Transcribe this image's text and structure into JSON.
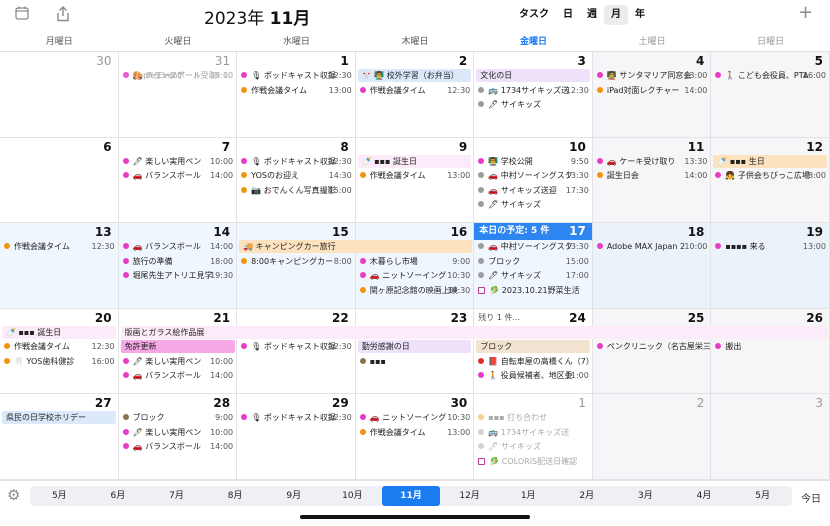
{
  "header": {
    "year": "2023年",
    "month": "11月",
    "views": [
      "タスク",
      "日",
      "週",
      "月",
      "年"
    ],
    "active_view": "月"
  },
  "weekdays": [
    "月曜日",
    "火曜日",
    "水曜日",
    "木曜日",
    "金曜日",
    "土曜日",
    "日曜日"
  ],
  "colors": {
    "orange": "#f0950e",
    "pink": "#e83cc5",
    "red": "#e03030",
    "blue": "#2b85f0",
    "gray": "#9c9c9c",
    "olive": "#8c7348",
    "purple": "#b070e0"
  },
  "cells": [
    {
      "day": "30",
      "dim": true,
      "events": []
    },
    {
      "day": "31",
      "dim": true,
      "events": [
        {
          "dot": "pink",
          "text": "Apple Event",
          "time": "9:00",
          "faded": true
        },
        {
          "dot": "pink",
          "text": "🚗 バランスボール",
          "time": "14:00",
          "faded": true
        },
        {
          "dot": "pink",
          "text": "🎨 チョークアート受取",
          "time": "15:10",
          "faded": true
        }
      ]
    },
    {
      "day": "1",
      "events": [
        {
          "dot": "pink",
          "text": "🎙 ポッドキャスト収録",
          "time": "12:30"
        },
        {
          "dot": "orange",
          "text": "作戦会議タイム",
          "time": "13:00",
          "row": 2
        }
      ]
    },
    {
      "day": "2",
      "events": [
        {
          "dot": "pink",
          "text": "作戦会議タイム",
          "time": "12:30",
          "row": 2
        }
      ],
      "bar": {
        "text": "🎌 👨‍🏫 校外学習（お弁当）",
        "color": "blue",
        "row": 1
      }
    },
    {
      "day": "3",
      "events": [
        {
          "dot": "gray",
          "text": "🚌 1734サイキッズ送",
          "time": "12:30",
          "row": 2
        },
        {
          "dot": "gray",
          "text": "🖊 サイキッズ",
          "time": "",
          "row": 3
        }
      ],
      "bar": {
        "text": "文化の日",
        "color": "lavender",
        "row": 1
      }
    },
    {
      "day": "4",
      "events": [
        {
          "dot": "pink",
          "text": "🧑‍🏫 サンタマリア同窓会",
          "time": "13:00"
        },
        {
          "dot": "orange",
          "text": "iPad対面レクチャー",
          "time": "14:00",
          "row": 2
        }
      ]
    },
    {
      "day": "5",
      "events": [
        {
          "dot": "pink",
          "text": "🚶 こども会役員、PTA",
          "time": "16:00"
        }
      ]
    },
    {
      "day": "6",
      "events": []
    },
    {
      "day": "7",
      "events": [
        {
          "dot": "pink",
          "text": "🖊 楽しい実用ペン",
          "time": "10:00"
        },
        {
          "dot": "pink",
          "text": "🚗 バランスボール",
          "time": "14:00",
          "row": 2
        }
      ]
    },
    {
      "day": "8",
      "events": [
        {
          "dot": "pink",
          "text": "🎙 ポッドキャスト収録",
          "time": "12:30"
        },
        {
          "dot": "orange",
          "text": "YOSのお迎え",
          "time": "14:30",
          "row": 2
        },
        {
          "dot": "orange",
          "text": "📷 おでんくん写真撮影",
          "time": "15:00",
          "row": 3
        }
      ]
    },
    {
      "day": "9",
      "events": [
        {
          "dot": "orange",
          "text": "作戦会議タイム",
          "time": "13:00",
          "row": 2
        }
      ],
      "bar": {
        "text": "🍼 ▪▪▪ 誕生日",
        "color": "lightpink",
        "row": 1
      }
    },
    {
      "day": "10",
      "events": [
        {
          "dot": "pink",
          "text": "👨‍🏫 学校公開",
          "time": "9:50"
        },
        {
          "dot": "gray",
          "text": "🚗 中村ソーイングスク",
          "time": "13:30",
          "row": 2
        },
        {
          "dot": "gray",
          "text": "🚗 サイキッズ送迎",
          "time": "17:30",
          "row": 3
        },
        {
          "dot": "gray",
          "text": "🖊 サイキッズ",
          "time": "",
          "row": 4
        }
      ]
    },
    {
      "day": "11",
      "events": [
        {
          "dot": "pink",
          "text": "🚗 ケーキ受け取り",
          "time": "13:30"
        },
        {
          "dot": "orange",
          "text": "誕生日会",
          "time": "14:00",
          "row": 2
        }
      ]
    },
    {
      "day": "12",
      "events": [
        {
          "dot": "pink",
          "text": "👧 子供会ちびっこ広場",
          "time": "8:00",
          "row": 2
        }
      ],
      "bar": {
        "text": "🍼 ▪▪▪ 生日",
        "color": "orange",
        "row": 1
      }
    },
    {
      "day": "13",
      "events": [
        {
          "dot": "orange",
          "text": "作戦会議タイム",
          "time": "12:30"
        }
      ]
    },
    {
      "day": "14",
      "events": [
        {
          "dot": "pink",
          "text": "🚗 バランスボール",
          "time": "14:00"
        },
        {
          "dot": "pink",
          "text": "旅行の準備",
          "time": "18:00",
          "row": 2
        },
        {
          "dot": "pink",
          "text": "堀尾先生アトリエ見学",
          "time": "19:30",
          "row": 3
        }
      ]
    },
    {
      "day": "15",
      "events": [
        {
          "dot": "orange",
          "text": "8:00キャンピングカー",
          "time": "8:00",
          "row": 2
        }
      ]
    },
    {
      "day": "16",
      "events": [
        {
          "dot": "pink",
          "text": "木暮らし市場",
          "time": "9:00",
          "row": 2
        },
        {
          "dot": "pink",
          "text": "🚗 ニットソーイング",
          "time": "10:30",
          "row": 3
        },
        {
          "dot": "orange",
          "text": "関ヶ原記念館の映画上映",
          "time": "14:30",
          "row": 4
        }
      ]
    },
    {
      "day": "17",
      "today": true,
      "today_label": "本日の予定: 5 件",
      "events": [
        {
          "dot": "gray",
          "text": "🚗 中村ソーイングスク",
          "time": "13:30",
          "row": 1
        },
        {
          "dot": "gray",
          "text": "ブロック",
          "time": "15:00",
          "row": 2
        },
        {
          "dot": "gray",
          "text": "🖊 サイキッズ",
          "time": "17:00",
          "row": 3
        },
        {
          "dot": "gray",
          "text": "🥬 2023.10.21野菜生活",
          "time": "",
          "row": 4,
          "checkbox": true
        }
      ]
    },
    {
      "day": "18",
      "events": [
        {
          "dot": "pink",
          "text": "Adobe MAX Japan 2",
          "time": "10:00"
        }
      ]
    },
    {
      "day": "19",
      "events": [
        {
          "dot": "pink",
          "text": "▪▪▪▪ 来る",
          "time": "13:00"
        }
      ]
    },
    {
      "day": "20",
      "events": [
        {
          "dot": "orange",
          "text": "作戦会議タイム",
          "time": "12:30",
          "row": 2
        },
        {
          "dot": "orange",
          "text": "🦷 YOS歯科健診",
          "time": "16:00",
          "row": 3
        }
      ],
      "bar": {
        "text": "🍼 ▪▪▪ 誕生日",
        "color": "lightpink",
        "row": 1
      }
    },
    {
      "day": "21",
      "events": [
        {
          "dot": "pink",
          "text": "🖊 楽しい実用ペン",
          "time": "10:00",
          "row": 3
        },
        {
          "dot": "pink",
          "text": "🚗 バランスボール",
          "time": "14:00",
          "row": 4
        }
      ]
    },
    {
      "day": "22",
      "events": [
        {
          "dot": "pink",
          "text": "🎙 ポッドキャスト収録",
          "time": "12:30",
          "row": 2
        }
      ]
    },
    {
      "day": "23",
      "events": [
        {
          "dot": "olive",
          "text": "▪▪▪",
          "time": "",
          "row": 3
        }
      ],
      "bar": {
        "text": "勤労感謝の日",
        "color": "lavender",
        "row": 2
      }
    },
    {
      "day": "24",
      "overflow": "残り 1 件...",
      "events": [
        {
          "dot": "red",
          "text": "📕 自転車屋の高橋くん（7）",
          "time": "",
          "row": 3
        },
        {
          "dot": "pink",
          "text": "🚶 役員候補者、地区委",
          "time": "11:00",
          "row": 4
        }
      ],
      "bar": {
        "text": "ブロック",
        "color": "tan",
        "row": 2
      }
    },
    {
      "day": "25",
      "events": [
        {
          "dot": "pink",
          "text": "ペンクリニック（名古屋栄三",
          "time": "",
          "row": 2
        }
      ]
    },
    {
      "day": "26",
      "events": [
        {
          "dot": "pink",
          "text": "搬出",
          "time": "",
          "row": 2
        }
      ]
    },
    {
      "day": "27",
      "events": [],
      "bar": {
        "text": "県民の日学校ホリデー",
        "color": "blue",
        "row": 1
      }
    },
    {
      "day": "28",
      "events": [
        {
          "dot": "olive",
          "text": "ブロック",
          "time": "9:00"
        },
        {
          "dot": "pink",
          "text": "🖊 楽しい実用ペン",
          "time": "10:00",
          "row": 2
        },
        {
          "dot": "pink",
          "text": "🚗 バランスボール",
          "time": "14:00",
          "row": 3
        }
      ]
    },
    {
      "day": "29",
      "events": [
        {
          "dot": "pink",
          "text": "🎙 ポッドキャスト収録",
          "time": "12:30"
        }
      ]
    },
    {
      "day": "30",
      "events": [
        {
          "dot": "pink",
          "text": "🚗 ニットソーイング",
          "time": "10:30"
        },
        {
          "dot": "orange",
          "text": "作戦会議タイム",
          "time": "13:00",
          "row": 2
        }
      ]
    },
    {
      "day": "1",
      "dim": true,
      "events": [
        {
          "dot": "orange",
          "text": "▪▪▪ 打ち合わせ",
          "time": "",
          "faded": true
        },
        {
          "dot": "gray",
          "text": "🚌 1734サイキッズ送",
          "time": "",
          "row": 2,
          "faded": true
        },
        {
          "dot": "gray",
          "text": "🖊 サイキッズ",
          "time": "",
          "row": 3,
          "faded": true
        },
        {
          "dot": "gray",
          "text": "🥬 COLORIS配送日確認",
          "time": "",
          "row": 4,
          "faded": true,
          "checkbox": true
        }
      ]
    },
    {
      "day": "2",
      "dim": true,
      "events": []
    },
    {
      "day": "3",
      "dim": true,
      "events": []
    }
  ],
  "span_bars": [
    {
      "text": "🚚 キャンピングカー旅行",
      "color": "orange",
      "week": 2,
      "start": 2,
      "end": 3,
      "row": 1
    },
    {
      "text": "版画とガラス絵作品展",
      "color": "lightpink",
      "week": 3,
      "start": 1,
      "end": 6,
      "row": 1
    },
    {
      "text": "免許更新",
      "color": "hotpink",
      "week": 3,
      "start": 1,
      "end": 1,
      "row": 2
    }
  ],
  "months": [
    "5月",
    "6月",
    "7月",
    "8月",
    "9月",
    "10月",
    "11月",
    "12月",
    "1月",
    "2月",
    "3月",
    "4月",
    "5月"
  ],
  "active_month_index": 6,
  "today_button": "今日"
}
